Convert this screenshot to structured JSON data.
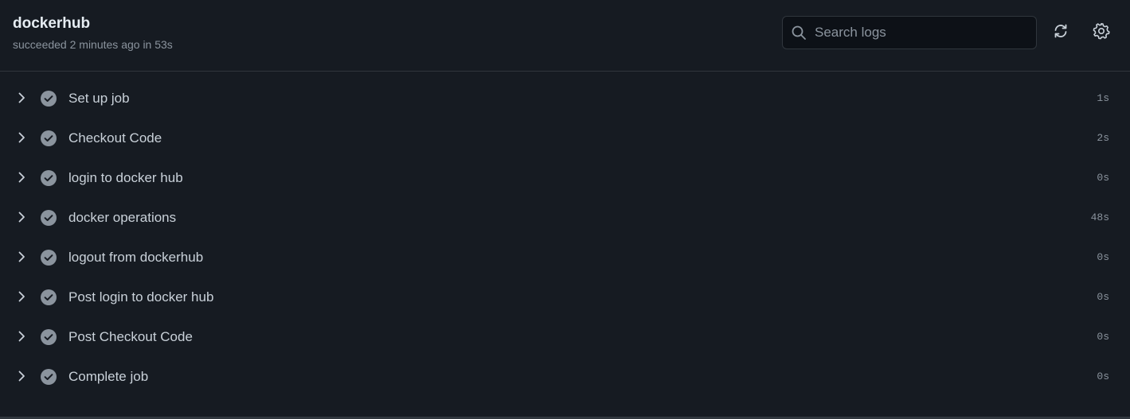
{
  "job": {
    "title": "dockerhub",
    "status": "succeeded 2 minutes ago in 53s"
  },
  "search": {
    "placeholder": "Search logs",
    "value": ""
  },
  "toolbar": {
    "refresh_icon": "sync-icon",
    "settings_icon": "gear-icon"
  },
  "steps": [
    {
      "name": "Set up job",
      "duration": "1s",
      "status": "success"
    },
    {
      "name": "Checkout Code",
      "duration": "2s",
      "status": "success"
    },
    {
      "name": "login to docker hub",
      "duration": "0s",
      "status": "success"
    },
    {
      "name": "docker operations",
      "duration": "48s",
      "status": "success"
    },
    {
      "name": "logout from dockerhub",
      "duration": "0s",
      "status": "success"
    },
    {
      "name": "Post login to docker hub",
      "duration": "0s",
      "status": "success"
    },
    {
      "name": "Post Checkout Code",
      "duration": "0s",
      "status": "success"
    },
    {
      "name": "Complete job",
      "duration": "0s",
      "status": "success"
    }
  ],
  "colors": {
    "background": "#161b22",
    "border": "#30363d",
    "text": "#c9d1d9",
    "muted": "#8b949e",
    "success_icon": "#8b949e"
  }
}
